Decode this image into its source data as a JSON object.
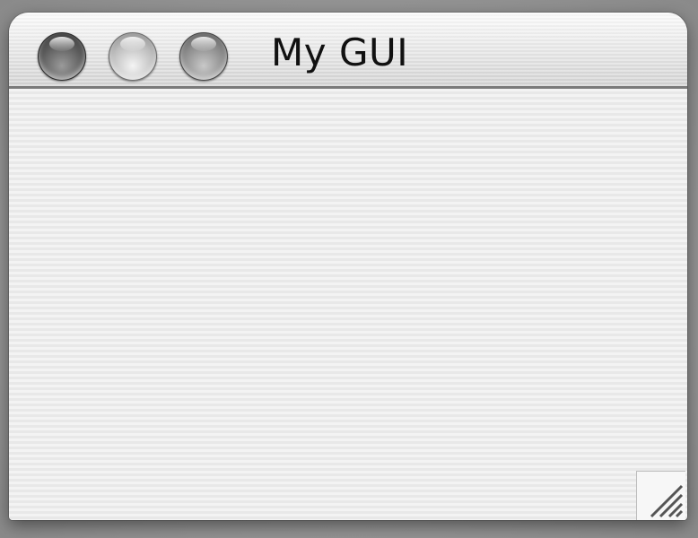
{
  "window": {
    "title": "My GUI",
    "buttons": {
      "close": "close-icon",
      "minimize": "minimize-icon",
      "zoom": "zoom-icon"
    },
    "resize_grip_icon": "resize-grip-icon"
  },
  "colors": {
    "titlebar": "#e6e6e6",
    "content_background": "#f0f0f0",
    "desktop": "#9a9a9a"
  }
}
